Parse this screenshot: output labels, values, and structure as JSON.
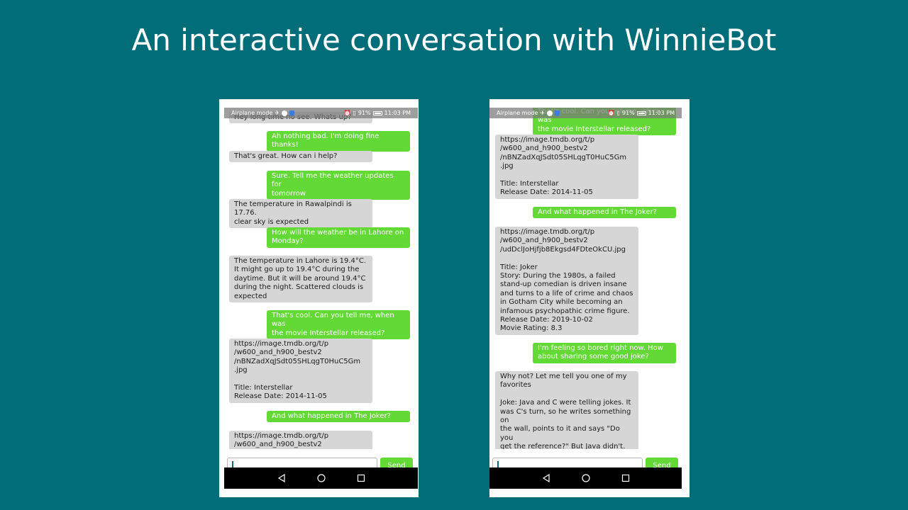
{
  "slide": {
    "title": "An interactive conversation with WinnieBot"
  },
  "colors": {
    "background": "#006d79",
    "bot_bubble": "#d6d6d6",
    "user_bubble": "#62d934",
    "send_button": "#62d934"
  },
  "phones": {
    "left": {
      "status": {
        "mode": "Airplane mode",
        "battery": "91%",
        "time": "11:03 PM"
      },
      "messages": [
        {
          "from": "bot",
          "text": "Hey long time no see. Whats up?"
        },
        {
          "from": "user",
          "text": "Ah nothing bad. I'm doing fine thanks!"
        },
        {
          "from": "bot",
          "text": "That's great. How can i help?"
        },
        {
          "from": "user",
          "text": "Sure. Tell me the weather updates for\ntomorrow"
        },
        {
          "from": "bot",
          "text": "The temperature in Rawalpindi is 17.76.\nclear sky is expected"
        },
        {
          "from": "user",
          "text": "How will the weather be in Lahore on\nMonday?"
        },
        {
          "from": "bot",
          "text": "The temperature in Lahore is 19.4°C.\nIt might go up to 19.4°C during the\ndaytime. But it will be around 19.4°C\nduring the night. Scattered clouds is\nexpected"
        },
        {
          "from": "user",
          "text": "That's cool. Can you tell me, when was\nthe movie Interstellar released?"
        },
        {
          "from": "bot",
          "text": "https://image.tmdb.org/t/p\n/w600_and_h900_bestv2\n/nBNZadXqJSdt05SHLqgT0HuC5Gm\n.jpg\n\nTitle: Interstellar\nRelease Date: 2014-11-05"
        },
        {
          "from": "user",
          "text": "And what happened in The Joker?"
        },
        {
          "from": "bot",
          "text": "https://image.tmdb.org/t/p\n/w600_and_h900_bestv2"
        }
      ],
      "send_label": "Send"
    },
    "right": {
      "status": {
        "mode": "Airplane mode",
        "battery": "91%",
        "time": "11:03 PM"
      },
      "messages": [
        {
          "from": "user",
          "text": "That's cool. Can you tell me, when was\nthe movie Interstellar released?"
        },
        {
          "from": "bot",
          "text": "https://image.tmdb.org/t/p\n/w600_and_h900_bestv2\n/nBNZadXqJSdt05SHLqgT0HuC5Gm\n.jpg\n\nTitle: Interstellar\nRelease Date: 2014-11-05"
        },
        {
          "from": "user",
          "text": "And what happened in The Joker?"
        },
        {
          "from": "bot",
          "text": "https://image.tmdb.org/t/p\n/w600_and_h900_bestv2\n/udDclJoHjfjb8Ekgsd4FDteOkCU.jpg\n\nTitle: Joker\nStory: During the 1980s, a failed\nstand-up comedian is driven insane\nand turns to a life of crime and chaos\nin Gotham City while becoming an\ninfamous psychopathic crime figure.\nRelease Date: 2019-10-02\nMovie Rating: 8.3"
        },
        {
          "from": "user",
          "text": "I'm feeling so bored right now. How\nabout sharing some good joke?"
        },
        {
          "from": "bot",
          "text": "Why not? Let me tell you one of my\nfavorites\n\nJoke: Java and C were telling jokes. It\nwas C's turn, so he writes something on\nthe wall, points to it and says \"Do you\nget the reference?\" But Java didn't. 😂\n😂"
        }
      ],
      "send_label": "Send"
    }
  }
}
